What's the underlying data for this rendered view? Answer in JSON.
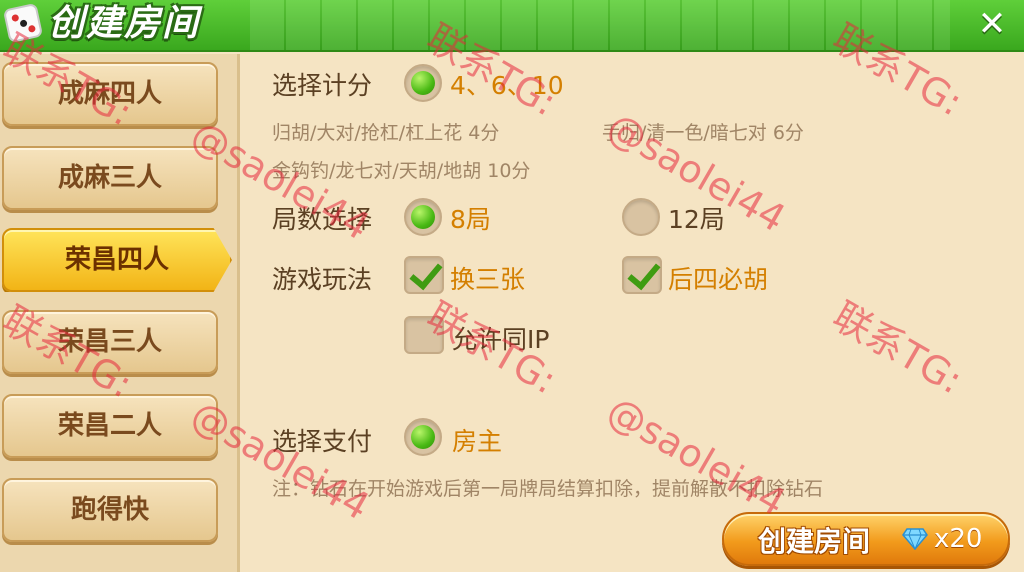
{
  "header": {
    "title": "创建房间",
    "close_glyph": "✕"
  },
  "sidebar": {
    "items": [
      {
        "label": "成麻四人"
      },
      {
        "label": "成麻三人"
      },
      {
        "label": "荣昌四人",
        "active": true
      },
      {
        "label": "荣昌三人"
      },
      {
        "label": "荣昌二人"
      },
      {
        "label": "跑得快"
      }
    ]
  },
  "scoring": {
    "label": "选择计分",
    "option": "4、6、10",
    "detail_1": "归胡/大对/抢杠/杠上花 4分",
    "detail_2": "手归/清一色/暗七对 6分",
    "detail_3": "金钩钓/龙七对/天胡/地胡 10分"
  },
  "rounds": {
    "label": "局数选择",
    "options": [
      {
        "label": "8局",
        "selected": true
      },
      {
        "label": "12局",
        "selected": false
      }
    ]
  },
  "gameplay": {
    "label": "游戏玩法",
    "options": [
      {
        "label": "换三张",
        "checked": true
      },
      {
        "label": "后四必胡",
        "checked": true
      },
      {
        "label": "允许同IP",
        "checked": false
      }
    ]
  },
  "payment": {
    "label": "选择支付",
    "option": "房主",
    "note": "注：钻石在开始游戏后第一局牌局结算扣除，提前解散不扣除钻石"
  },
  "create_button": {
    "label": "创建房间",
    "cost": "x20",
    "gem_icon": "diamond-icon"
  },
  "watermarks": {
    "contact": "联系TG:",
    "handle": "@saolei44"
  },
  "colors": {
    "header_green": "#3aa81e",
    "selected_text": "#d47f00",
    "active_tab": "#f2b416",
    "watermark": "#e6283c"
  }
}
